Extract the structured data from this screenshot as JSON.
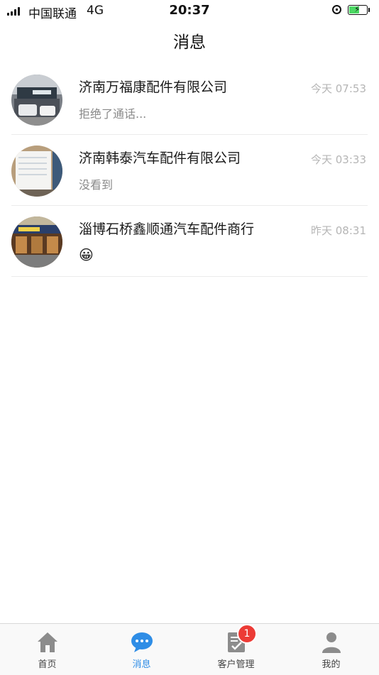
{
  "status_bar": {
    "carrier": "中国联通",
    "network": "4G",
    "time": "20:37",
    "battery_level": 0.55
  },
  "page": {
    "title": "消息"
  },
  "conversations": [
    {
      "name": "济南万福康配件有限公司",
      "preview": "拒绝了通话...",
      "time": "今天 07:53"
    },
    {
      "name": "济南韩泰汽车配件有限公司",
      "preview": "没看到",
      "time": "今天 03:33"
    },
    {
      "name": "淄博石桥鑫顺通汽车配件商行",
      "preview": "😀",
      "time": "昨天 08:31"
    }
  ],
  "tab_bar": {
    "tabs": [
      {
        "label": "首页",
        "icon": "home-icon"
      },
      {
        "label": "消息",
        "icon": "chat-bubble-icon"
      },
      {
        "label": "客户管理",
        "icon": "clipboard-check-icon",
        "badge": "1"
      },
      {
        "label": "我的",
        "icon": "person-icon"
      }
    ],
    "active_index": 1
  },
  "colors": {
    "accent": "#2e8de6",
    "badge": "#ec3b36",
    "icon_gray": "#8c8c8c",
    "time_text": "#b5b5b5",
    "preview_text": "#8a8a8a"
  }
}
